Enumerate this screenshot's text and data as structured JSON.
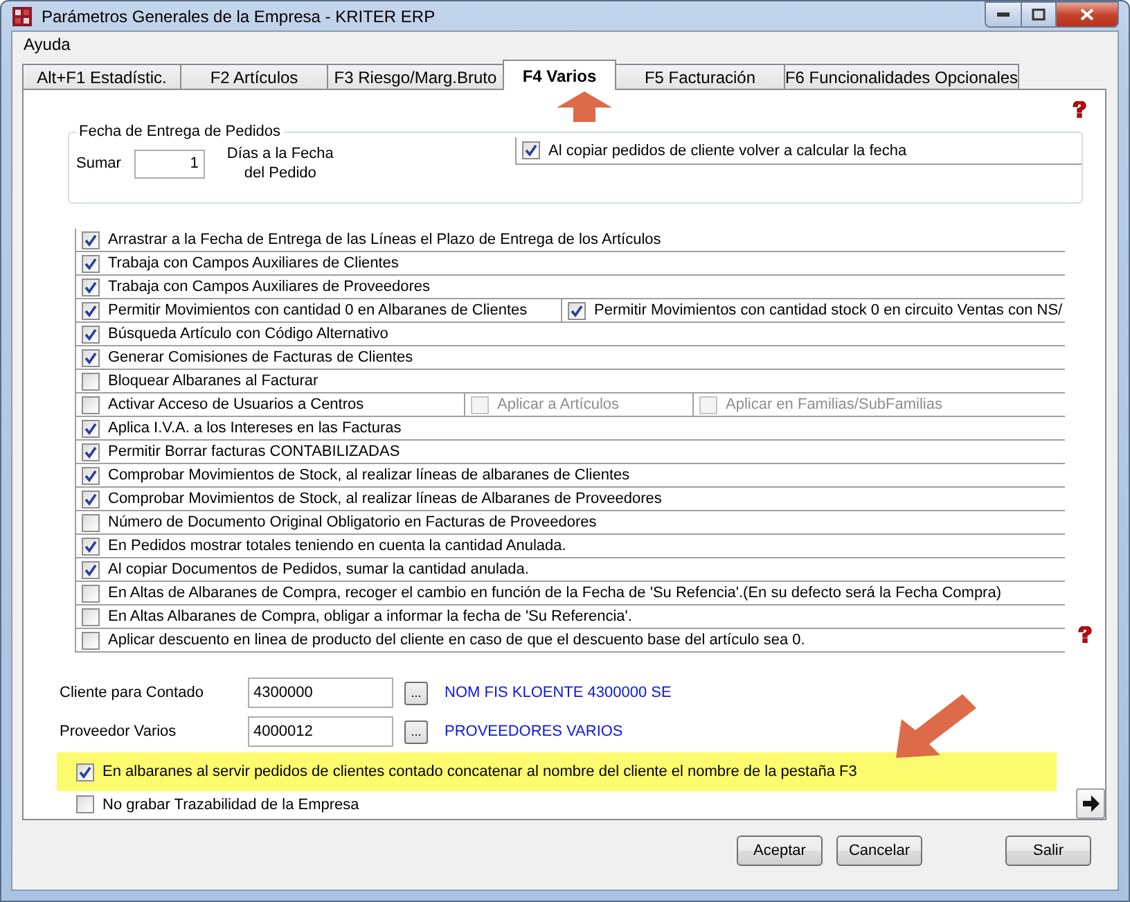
{
  "window": {
    "title": "Parámetros Generales de la Empresa - KRITER ERP"
  },
  "menu": [
    "Ayuda"
  ],
  "tabs": [
    {
      "label": "Alt+F1 Estadístic.",
      "selected": false
    },
    {
      "label": "F2 Artículos",
      "selected": false
    },
    {
      "label": "F3 Riesgo/Marg.Bruto",
      "selected": false
    },
    {
      "label": "F4 Varios",
      "selected": true
    },
    {
      "label": "F5 Facturación",
      "selected": false
    },
    {
      "label": "F6 Funcionalidades Opcionales",
      "selected": false
    }
  ],
  "delivery": {
    "legend": "Fecha de Entrega de Pedidos",
    "add_label": "Sumar",
    "days_value": "1",
    "days_label": "Días a la Fecha del Pedido",
    "recalc": {
      "label": "Al copiar pedidos de cliente volver a calcular la fecha",
      "checked": true
    }
  },
  "options": [
    {
      "label": "Arrastrar a la Fecha de Entrega de las Líneas el Plazo de Entrega de los Artículos",
      "checked": true
    },
    {
      "label": "Trabaja con Campos Auxiliares de Clientes",
      "checked": true
    },
    {
      "label": "Trabaja con Campos Auxiliares de Proveedores",
      "checked": true
    },
    {
      "label": "Permitir Movimientos con cantidad 0 en Albaranes de Clientes",
      "checked": true,
      "extras": [
        {
          "label": "Permitir Movimientos con cantidad stock 0 en circuito Ventas con NS/",
          "checked": true,
          "disabled": false
        }
      ]
    },
    {
      "label": "Búsqueda Artículo con Código Alternativo",
      "checked": true
    },
    {
      "label": "Generar Comisiones de Facturas de Clientes",
      "checked": true
    },
    {
      "label": "Bloquear Albaranes al Facturar",
      "checked": false
    },
    {
      "label": "Activar Acceso de Usuarios a Centros",
      "checked": false,
      "extras": [
        {
          "label": "Aplicar a Artículos",
          "checked": false,
          "disabled": true
        },
        {
          "label": "Aplicar en Familias/SubFamilias",
          "checked": false,
          "disabled": true
        }
      ]
    },
    {
      "label": "Aplica I.V.A. a los Intereses en las Facturas",
      "checked": true
    },
    {
      "label": "Permitir Borrar facturas CONTABILIZADAS",
      "checked": true
    },
    {
      "label": "Comprobar Movimientos de Stock, al realizar líneas de albaranes de Clientes",
      "checked": true
    },
    {
      "label": "Comprobar Movimientos de Stock, al realizar líneas de Albaranes de Proveedores",
      "checked": true
    },
    {
      "label": "Número de Documento Original Obligatorio en Facturas de Proveedores",
      "checked": false
    },
    {
      "label": "En Pedidos mostrar totales teniendo en cuenta la cantidad Anulada.",
      "checked": true
    },
    {
      "label": "Al copiar Documentos de Pedidos, sumar la cantidad anulada.",
      "checked": true
    },
    {
      "label": "En Altas de Albaranes de Compra, recoger el cambio en función de la Fecha de 'Su Refencia'.(En su defecto será la Fecha Compra)",
      "checked": false
    },
    {
      "label": "En Altas Albaranes de Compra, obligar a informar la fecha de 'Su Referencia'.",
      "checked": false
    },
    {
      "label": "Aplicar descuento en linea de producto del cliente en caso de que el descuento base del artículo sea 0.",
      "checked": false
    }
  ],
  "lookups": [
    {
      "label": "Cliente para Contado",
      "value": "4300000",
      "button": "...",
      "name": "NOM FIS KLOENTE 4300000 SE"
    },
    {
      "label": "Proveedor Varios",
      "value": "4000012",
      "button": "...",
      "name": "PROVEEDORES VARIOS"
    }
  ],
  "bottom_options": [
    {
      "label": "En albaranes al servir pedidos de clientes contado concatenar al nombre del cliente el nombre de la pestaña F3",
      "checked": true,
      "highlighted": true
    },
    {
      "label": "No grabar Trazabilidad de la Empresa",
      "checked": false,
      "highlighted": false
    }
  ],
  "buttons": [
    "Aceptar",
    "Cancelar",
    "Salir"
  ]
}
